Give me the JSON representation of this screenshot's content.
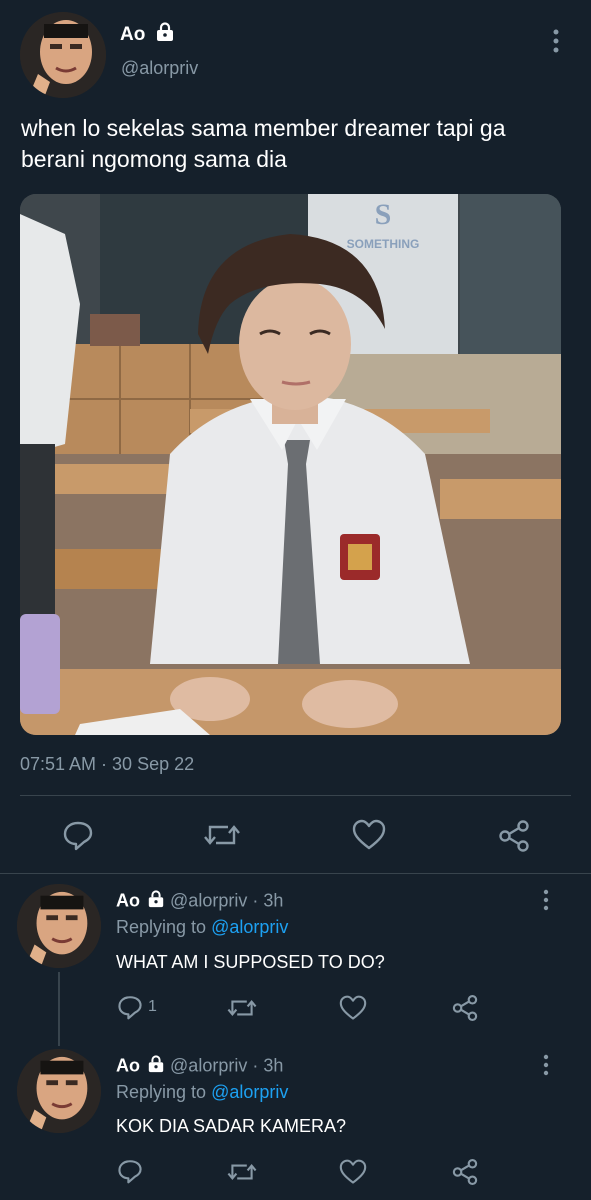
{
  "tweet": {
    "author_name": "Ao",
    "author_handle": "@alorpriv",
    "text": "when lo sekelas sama member dreamer tapi ga berani ngomong sama dia",
    "timestamp": "07:51 AM · 30 Sep 22",
    "photo_sign_text": "SOMETHING",
    "icons": [
      "reply-icon",
      "retweet-icon",
      "like-icon",
      "share-icon"
    ]
  },
  "replies": [
    {
      "author_name": "Ao",
      "handle_time": "@alorpriv · 3h",
      "replying_prefix": "Replying to",
      "replying_to": "@alorpriv",
      "text": "WHAT AM I SUPPOSED TO DO?",
      "reply_count": "1"
    },
    {
      "author_name": "Ao",
      "handle_time": "@alorpriv · 3h",
      "replying_prefix": "Replying to",
      "replying_to": "@alorpriv",
      "text": "KOK DIA SADAR KAMERA?",
      "reply_count": ""
    }
  ],
  "colors": {
    "background": "#15202b",
    "muted": "#8899a6",
    "link": "#1da1f2",
    "divider": "#38444d"
  }
}
